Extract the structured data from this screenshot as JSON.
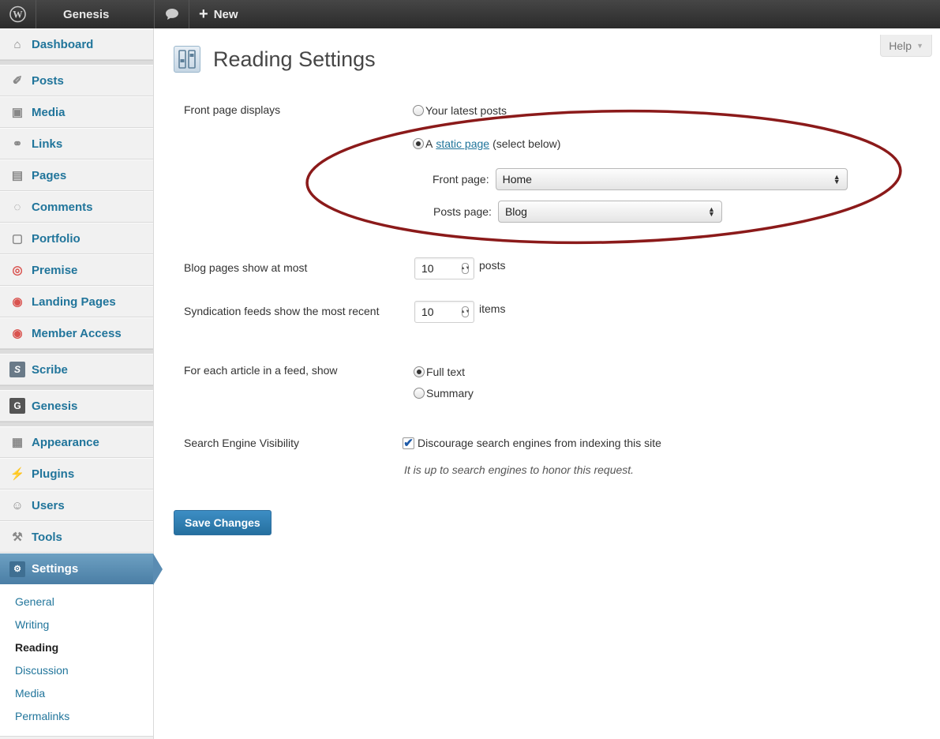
{
  "adminbar": {
    "site_name": "Genesis",
    "new_label": "New"
  },
  "sidebar": {
    "items": [
      {
        "label": "Dashboard"
      },
      {
        "label": "Posts"
      },
      {
        "label": "Media"
      },
      {
        "label": "Links"
      },
      {
        "label": "Pages"
      },
      {
        "label": "Comments"
      },
      {
        "label": "Portfolio"
      },
      {
        "label": "Premise"
      },
      {
        "label": "Landing Pages"
      },
      {
        "label": "Member Access"
      },
      {
        "label": "Scribe"
      },
      {
        "label": "Genesis"
      },
      {
        "label": "Appearance"
      },
      {
        "label": "Plugins"
      },
      {
        "label": "Users"
      },
      {
        "label": "Tools"
      },
      {
        "label": "Settings"
      }
    ],
    "settings_submenu": [
      {
        "label": "General"
      },
      {
        "label": "Writing"
      },
      {
        "label": "Reading"
      },
      {
        "label": "Discussion"
      },
      {
        "label": "Media"
      },
      {
        "label": "Permalinks"
      }
    ]
  },
  "help_label": "Help",
  "page_title": "Reading Settings",
  "front_page_displays": {
    "label": "Front page displays",
    "option_latest": "Your latest posts",
    "option_static_prefix": "A",
    "option_static_link": "static page",
    "option_static_suffix": "(select below)",
    "front_page_label": "Front page:",
    "front_page_value": "Home",
    "posts_page_label": "Posts page:",
    "posts_page_value": "Blog"
  },
  "blog_pages": {
    "label": "Blog pages show at most",
    "value": "10",
    "unit": "posts"
  },
  "syndication": {
    "label": "Syndication feeds show the most recent",
    "value": "10",
    "unit": "items"
  },
  "feed_article": {
    "label": "For each article in a feed, show",
    "option_full": "Full text",
    "option_summary": "Summary"
  },
  "search_visibility": {
    "label": "Search Engine Visibility",
    "checkbox_label": "Discourage search engines from indexing this site",
    "description": "It is up to search engines to honor this request."
  },
  "save_button": "Save Changes",
  "colors": {
    "link": "#21759b",
    "active_menu": "#5a8cb2",
    "annotation": "#8b1a1a"
  }
}
